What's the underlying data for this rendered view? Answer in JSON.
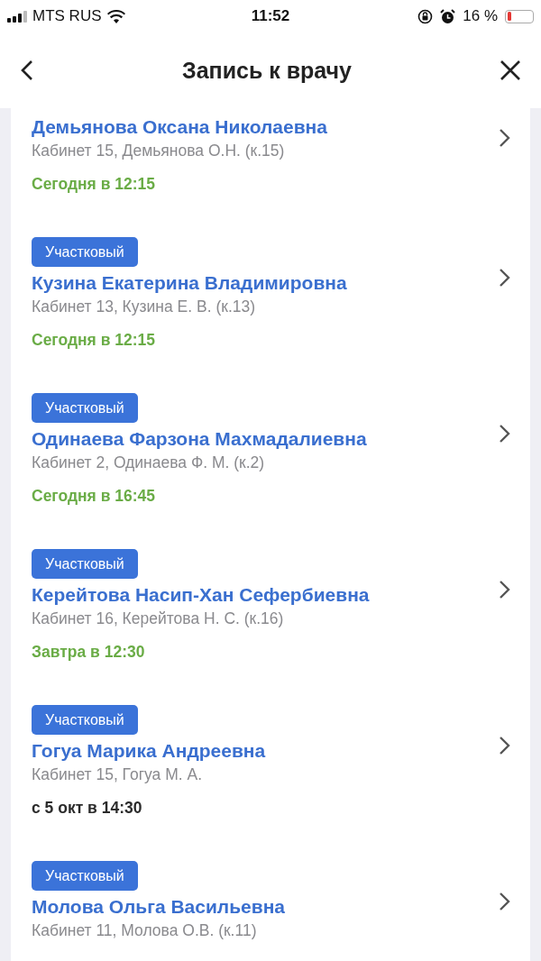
{
  "status_bar": {
    "carrier": "MTS RUS",
    "time": "11:52",
    "battery_percent": "16 %",
    "battery": {
      "level": 0.16
    }
  },
  "header": {
    "title": "Запись к врачу"
  },
  "doctors": [
    {
      "name": "Демьянова Оксана Николаевна",
      "room": "Кабинет 15, Демьянова О.Н. (к.15)",
      "time": "Сегодня в 12:15",
      "color": "#6aac46"
    },
    {
      "badge": "Участковый",
      "name": "Кузина Екатерина Владимировна",
      "room": "Кабинет 13, Кузина Е. В. (к.13)",
      "time": "Сегодня в 12:15",
      "color": "#6aac46"
    },
    {
      "badge": "Участковый",
      "name": "Одинаева Фарзона Махмадалиевна",
      "room": "Кабинет 2, Одинаева Ф. М. (к.2)",
      "time": "Сегодня в 16:45",
      "color": "#6aac46"
    },
    {
      "badge": "Участковый",
      "name": "Керейтова Насип-Хан Сефербиевна",
      "room": "Кабинет 16, Керейтова Н. С. (к.16)",
      "time": "Завтра в 12:30",
      "color": "#6aac46"
    },
    {
      "badge": "Участковый",
      "name": "Гогуа Марика Андреевна",
      "room": "Кабинет 15, Гогуа М. А.",
      "time": "с 5 окт в 14:30",
      "color": "#2b2b2b"
    },
    {
      "badge": "Участковый",
      "name": "Молова Ольга Васильевна",
      "room": "Кабинет 11, Молова О.В. (к.11)"
    }
  ]
}
